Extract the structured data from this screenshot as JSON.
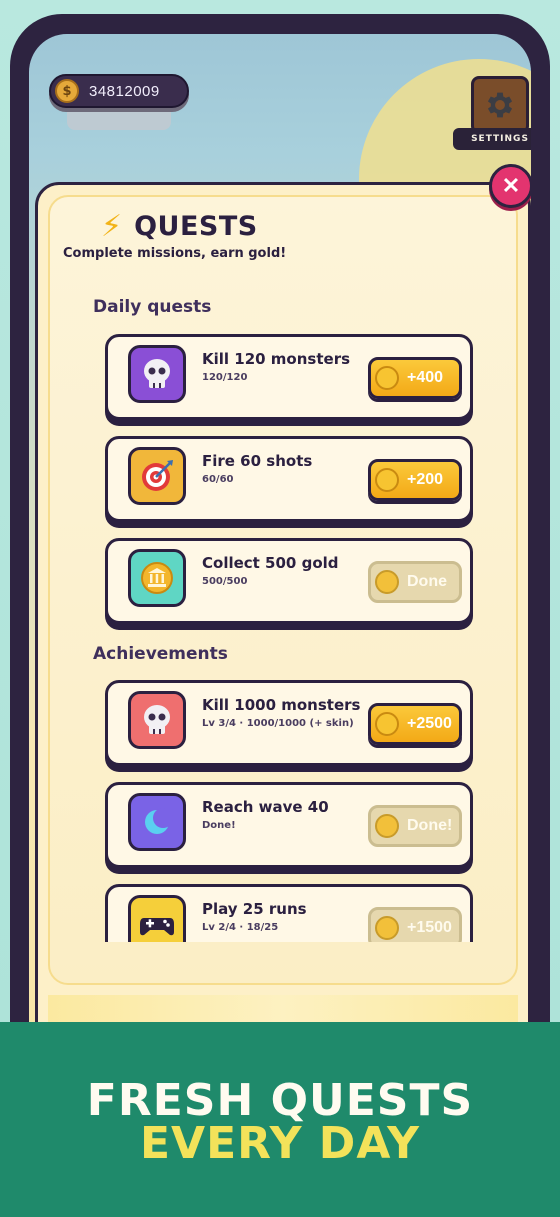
{
  "hud": {
    "gold_icon": "$",
    "gold_value": "34812009",
    "settings_label": "SETTINGS"
  },
  "panel": {
    "title_icon": "⚡",
    "title": "QUESTS",
    "subtitle": "Complete missions, earn gold!",
    "close_glyph": "✕"
  },
  "sections": {
    "daily": "Daily quests",
    "achievements": "Achievements"
  },
  "daily_quests": [
    {
      "title": "Kill 120 monsters",
      "progress": "120/120",
      "reward": "+400",
      "icon": "skull-icon",
      "state": "claimable"
    },
    {
      "title": "Fire 60 shots",
      "progress": "60/60",
      "reward": "+200",
      "icon": "target-icon",
      "state": "claimable"
    },
    {
      "title": "Collect 500 gold",
      "progress": "500/500",
      "reward": "Done",
      "icon": "bank-icon",
      "state": "done"
    }
  ],
  "achievements": [
    {
      "title": "Kill 1000 monsters",
      "progress": "Lv 3/4 · 1000/1000 (+ skin)",
      "reward": "+2500",
      "icon": "skull-icon",
      "state": "claimable"
    },
    {
      "title": "Reach wave 40",
      "progress": "Done!",
      "reward": "Done!",
      "icon": "moon-icon",
      "state": "done"
    },
    {
      "title": "Play 25 runs",
      "progress": "Lv 2/4 · 18/25",
      "reward": "+1500",
      "icon": "gamepad-icon",
      "state": "locked"
    }
  ],
  "banner": {
    "line1": "FRESH QUESTS",
    "line2": "EVERY DAY"
  }
}
